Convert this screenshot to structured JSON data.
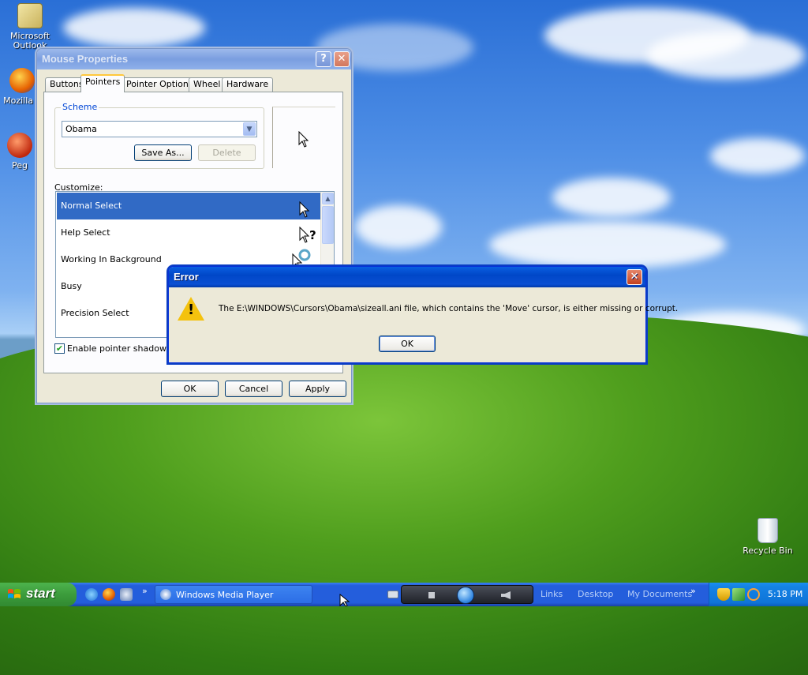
{
  "desktop": {
    "icons": [
      {
        "label": "Microsoft Outlook",
        "icon": "outlook-icon"
      },
      {
        "label": "Mozilla F",
        "icon": "firefox-icon"
      },
      {
        "label": "Peg",
        "icon": "pegasus-icon"
      },
      {
        "label": "Recycle Bin",
        "icon": "recycle-bin-icon"
      }
    ]
  },
  "mouse_properties": {
    "title": "Mouse Properties",
    "help_glyph": "?",
    "close_glyph": "✕",
    "tabs": [
      "Buttons",
      "Pointers",
      "Pointer Options",
      "Wheel",
      "Hardware"
    ],
    "active_tab": "Pointers",
    "scheme": {
      "label": "Scheme",
      "value": "Obama",
      "save_as": "Save As...",
      "delete": "Delete"
    },
    "customize_label": "Customize:",
    "cursors": [
      {
        "name": "Normal Select",
        "icon": "arrow-cursor-icon",
        "selected": true
      },
      {
        "name": "Help Select",
        "icon": "help-cursor-icon",
        "selected": false
      },
      {
        "name": "Working In Background",
        "icon": "working-cursor-icon",
        "selected": false
      },
      {
        "name": "Busy",
        "icon": "busy-cursor-icon",
        "selected": false
      },
      {
        "name": "Precision Select",
        "icon": "crosshair-cursor-icon",
        "selected": false
      }
    ],
    "shadow_label": "Enable pointer shadow",
    "shadow_checked": true,
    "buttons": {
      "ok": "OK",
      "cancel": "Cancel",
      "apply": "Apply"
    }
  },
  "error_dialog": {
    "title": "Error",
    "close_glyph": "✕",
    "message": "The E:\\WINDOWS\\Cursors\\Obama\\sizeall.ani file, which contains the 'Move' cursor, is either missing or corrupt.",
    "ok": "OK",
    "icon": "warning-icon"
  },
  "taskbar": {
    "start_label": "start",
    "quick_launch": [
      "ie-icon",
      "firefox-icon",
      "settings-icon"
    ],
    "chevron": "»",
    "tasks": [
      {
        "label": "Windows Media Player",
        "icon": "media-player-icon"
      }
    ],
    "links": [
      "Links",
      "Desktop",
      "My Documents"
    ],
    "clock": "5:18 PM",
    "tray_icons": [
      "shield-icon",
      "network-icon",
      "search-icon"
    ]
  },
  "colors": {
    "titlebar_active": "#0a5fe0",
    "selection": "#316ac5",
    "taskbar": "#245edc",
    "start_button": "#3c9c3c"
  }
}
